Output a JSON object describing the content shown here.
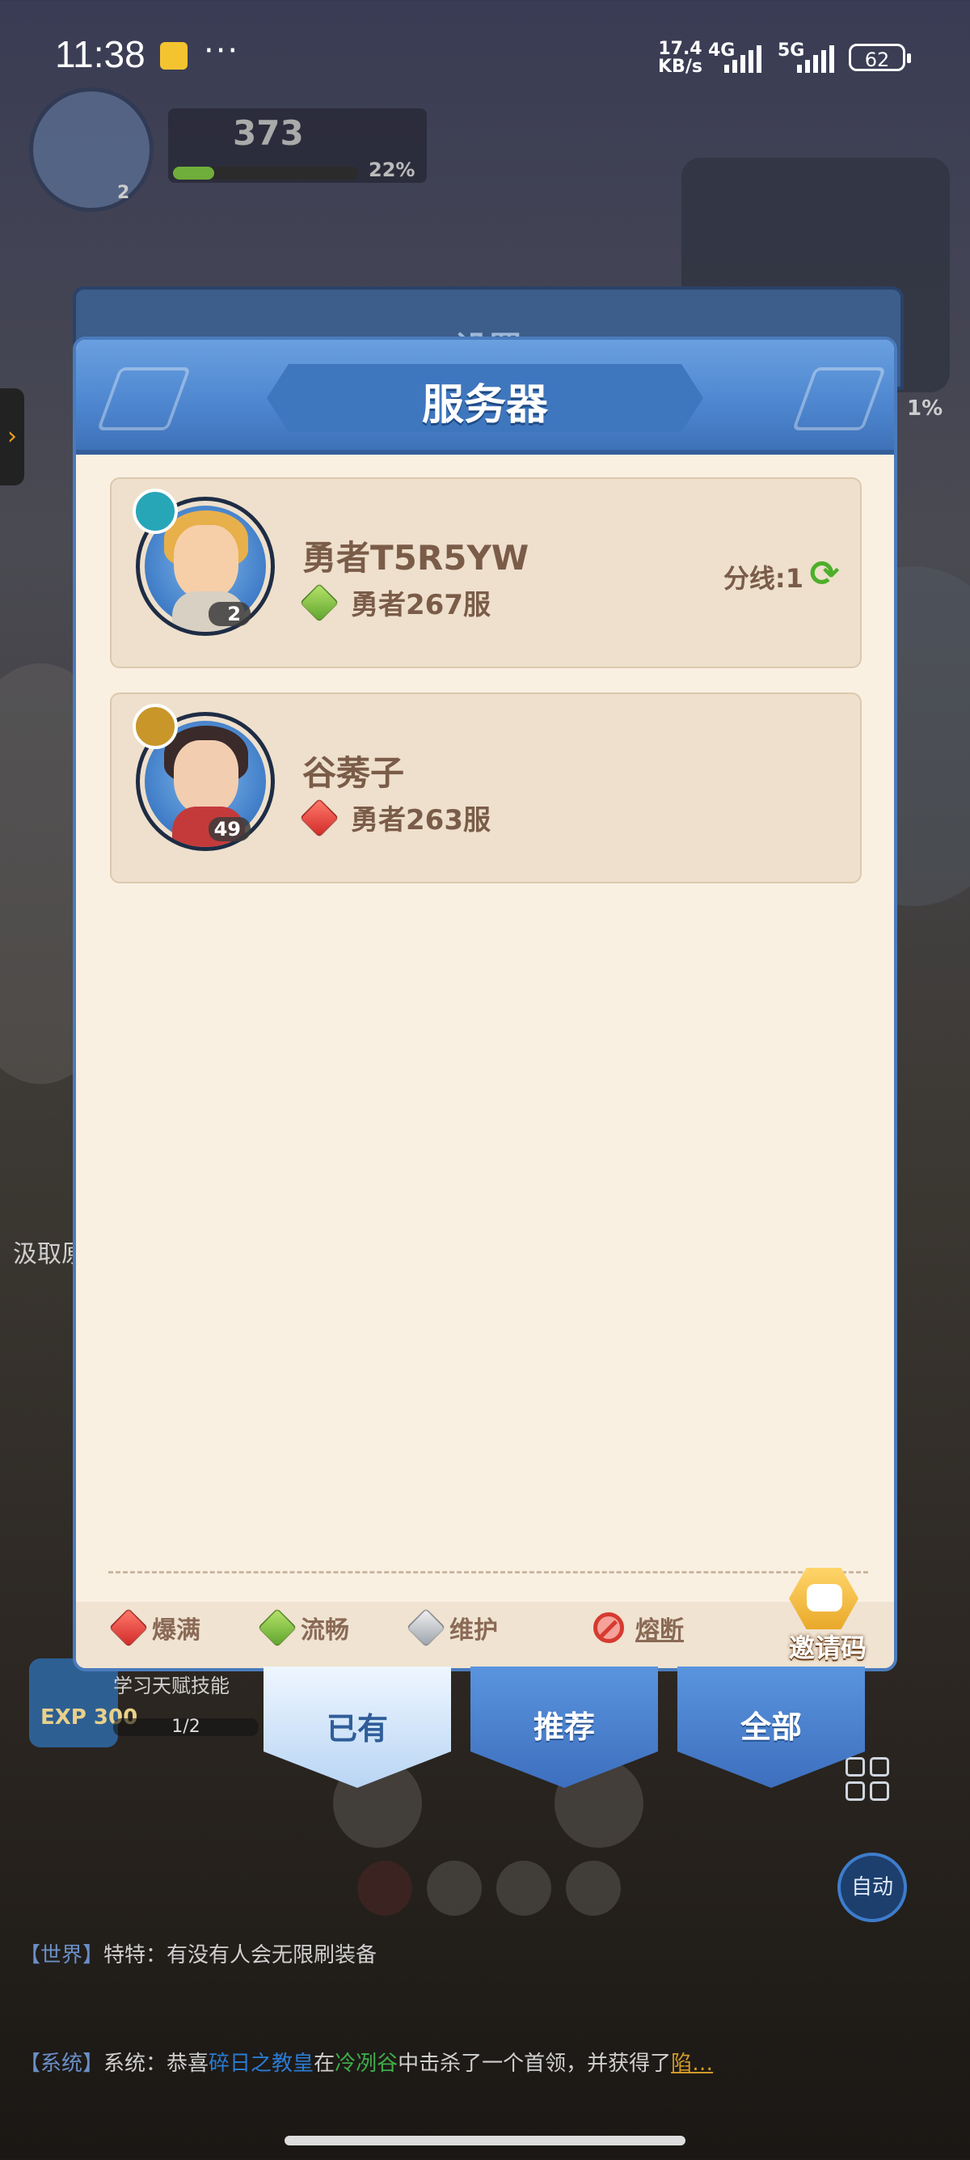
{
  "status_bar": {
    "time": "11:38",
    "more": "···",
    "net_speed_value": "17.4",
    "net_speed_unit": "KB/s",
    "sim1": "4G",
    "sim2": "5G",
    "battery": "62"
  },
  "hud": {
    "level": "2",
    "power": "373",
    "power_progress": "22%",
    "side_percent": "1%",
    "left_label": "汲取原"
  },
  "dialog": {
    "back_title": "设置",
    "title": "服务器",
    "servers": [
      {
        "player_name": "勇者T5R5YW",
        "server_name": "勇者267服",
        "status": "流畅",
        "level": "2",
        "branch": "分线:1"
      },
      {
        "player_name": "谷莠子",
        "server_name": "勇者263服",
        "status": "爆满",
        "level": "49",
        "branch": ""
      }
    ],
    "legend": {
      "full": "爆满",
      "smooth": "流畅",
      "maintenance": "维护",
      "fused": "熔断"
    },
    "invite_label": "邀请码"
  },
  "tabs": [
    {
      "label": "已有",
      "active": true
    },
    {
      "label": "推荐",
      "active": false
    },
    {
      "label": "全部",
      "active": false
    }
  ],
  "lower_hud": {
    "exp_label": "EXP 300",
    "task_text": "学习天赋技能",
    "task_progress": "1/2",
    "auto_label": "自动"
  },
  "chat": {
    "line1_tag": "【世界】",
    "line1_speaker": "特特：",
    "line1_text": "有没有人会无限刷装备",
    "line2_tag": "【系统】",
    "line2_speaker": "系统：",
    "line2_a": "恭喜",
    "line2_player": "碎日之教皇",
    "line2_b": "在",
    "line2_place": "冷冽谷",
    "line2_c": "中击杀了一个首领，并获得了",
    "line2_item": "陷…"
  },
  "colors": {
    "dialog_bg": "#faf0e2",
    "header_blue": "#4d86cf",
    "text_brown": "#7a5c49",
    "smooth_green": "#5fa52e",
    "full_red": "#d22a2a"
  }
}
